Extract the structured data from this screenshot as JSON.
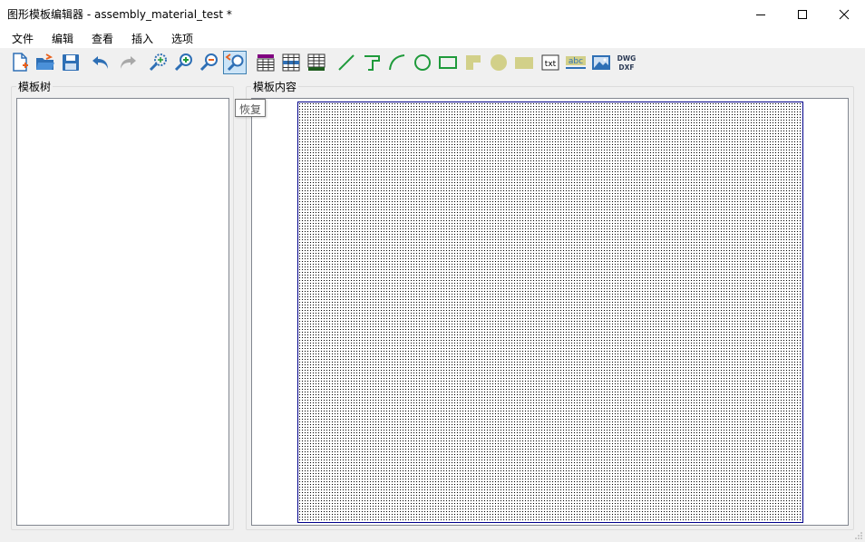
{
  "window": {
    "title": "图形模板编辑器 - assembly_material_test *"
  },
  "menu": [
    {
      "label": "文件"
    },
    {
      "label": "编辑"
    },
    {
      "label": "查看"
    },
    {
      "label": "插入"
    },
    {
      "label": "选项"
    }
  ],
  "toolbar": {
    "active_tool": "restore",
    "tooltip": "恢复",
    "dwg_line1": "DWG",
    "dwg_line2": "DXF",
    "txt_label": "txt",
    "abc_label": "abc",
    "icons": [
      "new-file-icon",
      "open-file-icon",
      "save-icon",
      "undo-icon",
      "redo-icon",
      "zoom-fit-icon",
      "zoom-in-icon",
      "zoom-out-icon",
      "restore-zoom-icon",
      "table-icon",
      "table-icon-2",
      "table-icon-3",
      "line-icon",
      "polyline-icon",
      "arc-icon",
      "circle-icon",
      "rectangle-icon",
      "filled-polygon-icon",
      "filled-circle-icon",
      "filled-rectangle-icon",
      "text-icon",
      "attribute-text-icon",
      "image-icon",
      "dwg-dxf-icon"
    ]
  },
  "left_panel": {
    "label": "模板树"
  },
  "right_panel": {
    "label": "模板内容"
  },
  "colors": {
    "accent": "#3c7fb1",
    "page_border": "#00008b",
    "shape_fill": "#d2d089",
    "shape_stroke": "#1f9a3b",
    "table_purple": "#800080",
    "table_green": "#1e5b1e"
  }
}
